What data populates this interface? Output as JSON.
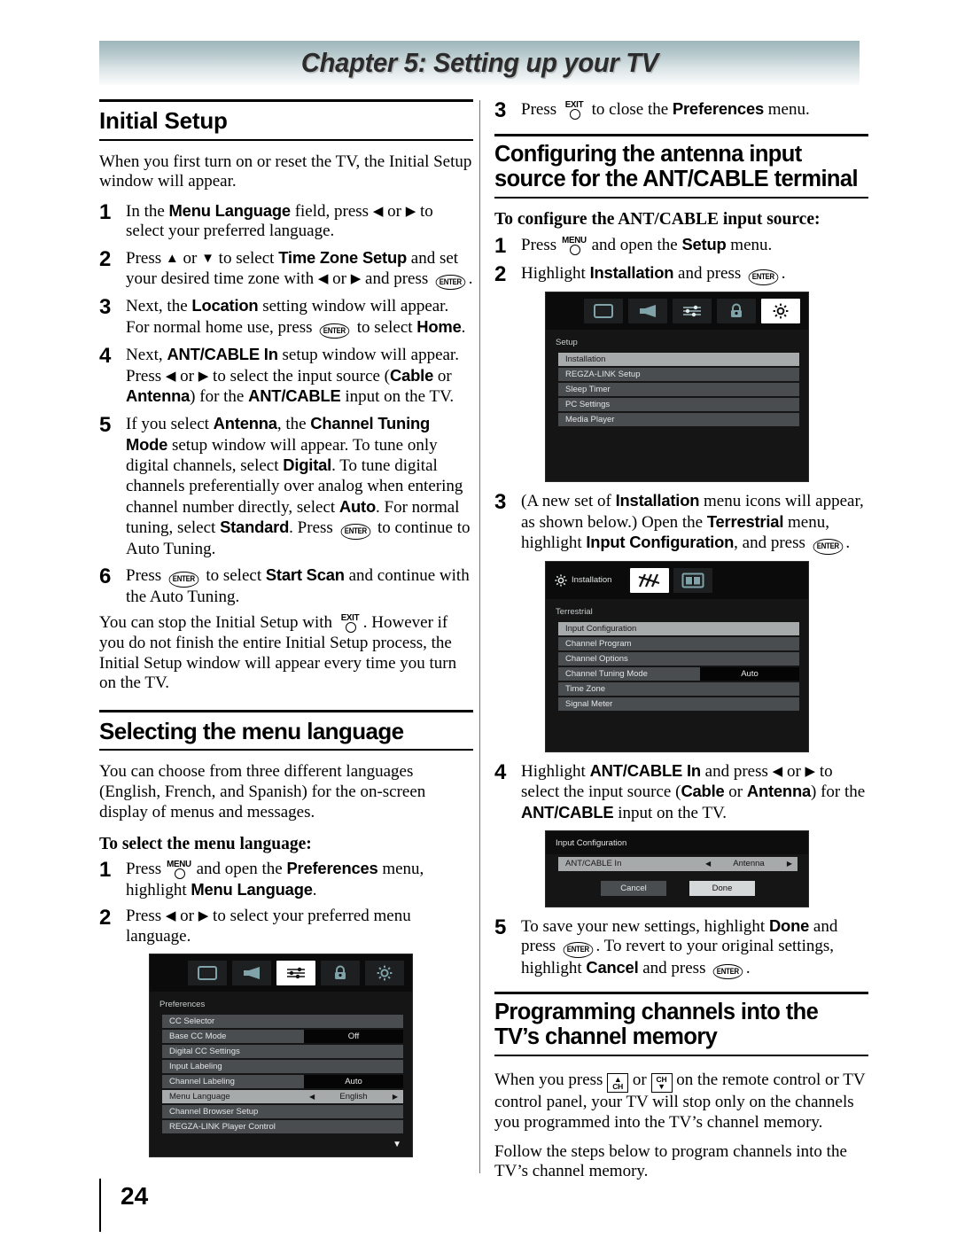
{
  "chapter": {
    "title": "Chapter 5: Setting up your TV"
  },
  "page": {
    "number": "24"
  },
  "left": {
    "heading_initial_setup": "Initial Setup",
    "intro": "When you first turn on or reset the TV, the Initial Setup window will appear.",
    "steps": [
      {
        "num": "1",
        "text_parts": [
          "In the ",
          "Menu Language",
          " field, press ",
          "◀",
          " or ",
          "▶",
          " to select your preferred language."
        ]
      },
      {
        "num": "2",
        "text": "Press ▲ or ▼ to select Time Zone Setup and set your desired time zone with ◀ or ▶ and press ENTER."
      },
      {
        "num": "3",
        "text": "Next, the Location setting window will appear. For normal home use, press ENTER to select Home."
      },
      {
        "num": "4",
        "text": "Next, ANT/CABLE In setup window will appear. Press ◀ or ▶ to select the input source (Cable or Antenna) for the ANT/CABLE input on the TV."
      },
      {
        "num": "5",
        "text": "If you select Antenna, the Channel Tuning Mode setup window will appear. To tune only digital channels, select Digital. To tune digital channels preferentially over analog when entering channel number directly, select Auto. For normal tuning, select Standard. Press ENTER to continue to Auto Tuning."
      },
      {
        "num": "6",
        "text": "Press ENTER to select Start Scan and continue with the Auto Tuning."
      }
    ],
    "note": "You can stop the Initial Setup with EXIT. However if you do not finish the entire Initial Setup process, the Initial Setup window will appear every time you turn on the TV.",
    "heading_menu_language": "Selecting the menu language",
    "language_para": "You can choose from three different languages (English, French, and Spanish) for the on-screen display of menus and messages.",
    "subheading_select_menu_language": "To select the menu language:",
    "lang_steps": [
      {
        "num": "1",
        "text": "Press MENU and open the Preferences menu, highlight Menu Language."
      },
      {
        "num": "2",
        "text": "Press ◀ or ▶ to select your preferred menu language."
      }
    ]
  },
  "right": {
    "step3_top": {
      "num": "3",
      "text": "Press EXIT to close the Preferences menu."
    },
    "heading_configuring": "Configuring the antenna input source for the ANT/CABLE terminal",
    "subheading_configure": "To configure the ANT/CABLE input source:",
    "steps": [
      {
        "num": "1",
        "text": "Press MENU and open the Setup menu."
      },
      {
        "num": "2",
        "text": "Highlight Installation and press ENTER."
      },
      {
        "num": "3",
        "text": "(A new set of Installation menu icons will appear, as shown below.) Open the Terrestrial menu, highlight Input Configuration, and press ENTER."
      },
      {
        "num": "4",
        "text": "Highlight ANT/CABLE In and press ◀ or ▶ to select the input source (Cable or Antenna) for the ANT/CABLE input on the TV."
      },
      {
        "num": "5",
        "text": "To save your new settings, highlight Done and press ENTER. To revert to your original settings, highlight Cancel and press ENTER."
      }
    ],
    "heading_programming": "Programming channels into the TV’s channel memory",
    "prog_para_1": "When you press CH▲ or CH▼ on the remote control or TV control panel, your TV will stop only on the channels you programmed into the TV’s channel memory.",
    "prog_para_2": "Follow the steps below to program channels into the TV’s channel memory."
  },
  "tv_menus": {
    "preferences": {
      "breadcrumb": "Preferences",
      "icons": [
        "picture-icon",
        "sound-icon",
        "preferences-icon",
        "lock-icon",
        "setup-icon"
      ],
      "selected_icon_index": 2,
      "rows": [
        {
          "label": "CC Selector",
          "value": ""
        },
        {
          "label": "Base CC Mode",
          "value": "Off"
        },
        {
          "label": "Digital CC Settings",
          "value": ""
        },
        {
          "label": "Input Labeling",
          "value": ""
        },
        {
          "label": "Channel Labeling",
          "value": "Auto"
        },
        {
          "label": "Menu Language",
          "value": "English",
          "adjustable": true,
          "selected": true
        },
        {
          "label": "Channel Browser Setup",
          "value": ""
        },
        {
          "label": "REGZA-LINK Player Control",
          "value": ""
        }
      ],
      "scroll_indicator": "▼"
    },
    "setup": {
      "breadcrumb": "Setup",
      "icons": [
        "picture-icon",
        "sound-icon",
        "preferences-icon",
        "lock-icon",
        "setup-icon"
      ],
      "selected_icon_index": 4,
      "rows": [
        {
          "label": "Installation",
          "value": "",
          "selected": true
        },
        {
          "label": "REGZA-LINK Setup",
          "value": ""
        },
        {
          "label": "Sleep Timer",
          "value": ""
        },
        {
          "label": "PC Settings",
          "value": ""
        },
        {
          "label": "Media Player",
          "value": ""
        }
      ]
    },
    "installation": {
      "title": "Installation",
      "breadcrumb": "Terrestrial",
      "icons": [
        "antenna-icon",
        "tv-input-icon"
      ],
      "selected_icon_index": 0,
      "rows": [
        {
          "label": "Input Configuration",
          "value": "",
          "selected": true
        },
        {
          "label": "Channel Program",
          "value": ""
        },
        {
          "label": "Channel Options",
          "value": ""
        },
        {
          "label": "Channel Tuning Mode",
          "value": "Auto"
        },
        {
          "label": "Time Zone",
          "value": ""
        },
        {
          "label": "Signal Meter",
          "value": ""
        }
      ]
    },
    "input_configuration": {
      "title": "Input Configuration",
      "row": {
        "label": "ANT/CABLE In",
        "value": "Antenna"
      },
      "cancel_label": "Cancel",
      "done_label": "Done"
    }
  }
}
